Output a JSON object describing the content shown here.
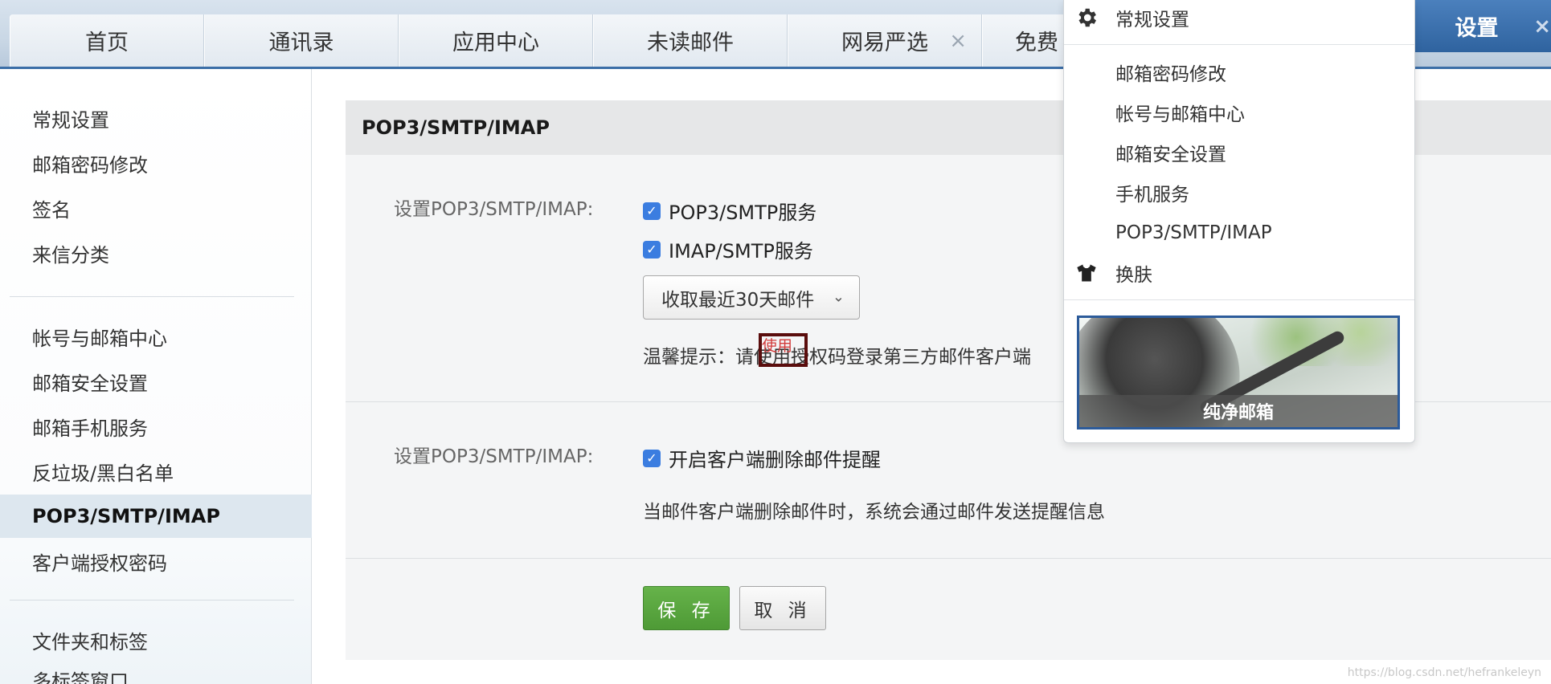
{
  "tabs": [
    {
      "label": "首页"
    },
    {
      "label": "通讯录"
    },
    {
      "label": "应用中心"
    },
    {
      "label": "未读邮件"
    },
    {
      "label": "网易严选",
      "close": "×"
    },
    {
      "label": "免费"
    }
  ],
  "active_tab": {
    "label": "设置",
    "close": "×"
  },
  "sidebar": {
    "items": [
      {
        "label": "常规设置"
      },
      {
        "label": "邮箱密码修改"
      },
      {
        "label": "签名"
      },
      {
        "label": "来信分类"
      },
      {
        "label": "帐号与邮箱中心"
      },
      {
        "label": "邮箱安全设置"
      },
      {
        "label": "邮箱手机服务"
      },
      {
        "label": "反垃圾/黑白名单"
      },
      {
        "label": "POP3/SMTP/IMAP",
        "active": true
      },
      {
        "label": "客户端授权密码"
      },
      {
        "label": "文件夹和标签"
      },
      {
        "label": "多标签窗口"
      }
    ]
  },
  "main": {
    "title": "POP3/SMTP/IMAP",
    "section1": {
      "label": "设置POP3/SMTP/IMAP:",
      "pop3_label": "POP3/SMTP服务",
      "pop3_checked": true,
      "imap_label": "IMAP/SMTP服务",
      "imap_checked": true,
      "fetch_select": "收取最近30天邮件",
      "hint": "温馨提示：请使用授权码登录第三方邮件客户端",
      "hint_annotation": "使用"
    },
    "section2": {
      "label": "设置POP3/SMTP/IMAP:",
      "delete_notice_label": "开启客户端删除邮件提醒",
      "delete_notice_checked": true,
      "description": "当邮件客户端删除邮件时，系统会通过邮件发送提醒信息"
    },
    "save_label": "保 存",
    "cancel_label": "取 消"
  },
  "menu": {
    "general": "常规设置",
    "items": [
      "邮箱密码修改",
      "帐号与邮箱中心",
      "邮箱安全设置",
      "手机服务",
      "POP3/SMTP/IMAP"
    ],
    "skin": "换肤",
    "skin_preview_label": "纯净邮箱"
  },
  "watermark": "https://blog.csdn.net/hefrankeleyn",
  "colors": {
    "accent": "#3b6ea7",
    "save": "#5aa53f",
    "checkbox": "#3b7de0",
    "active_sidebar": "#dde7ef"
  }
}
